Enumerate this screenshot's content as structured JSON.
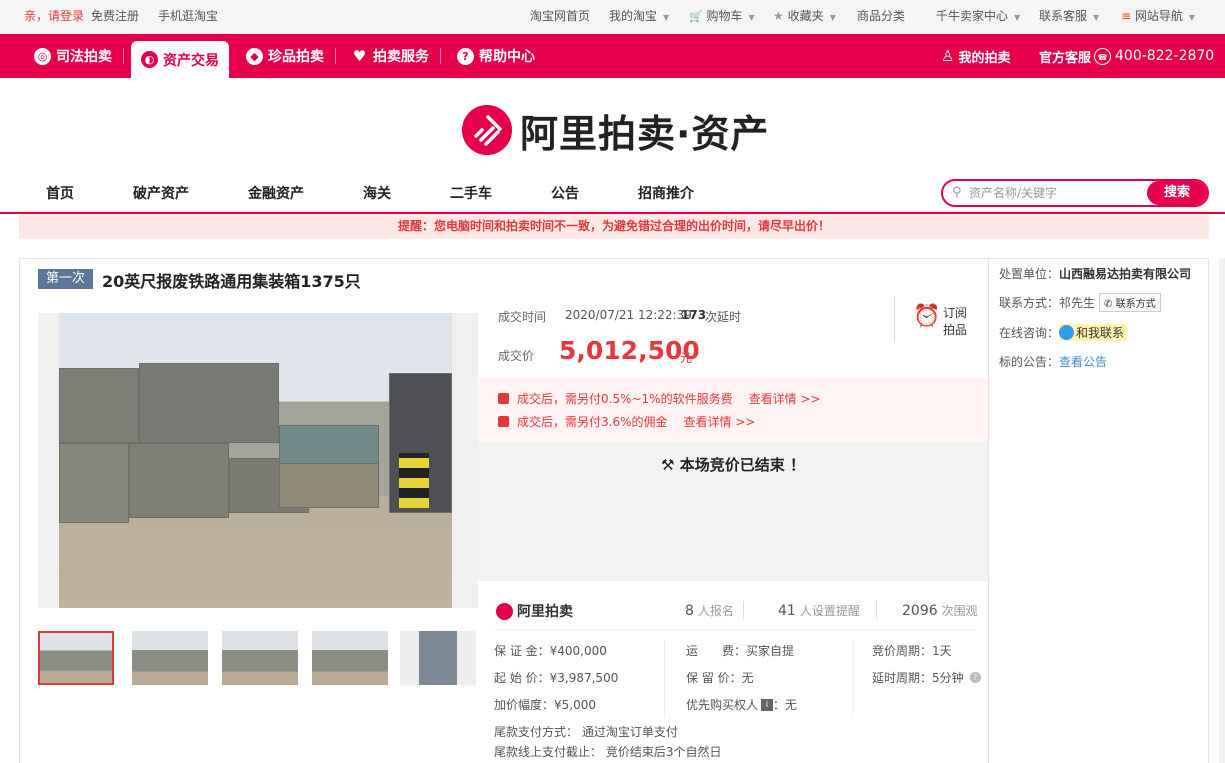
{
  "sitenav": {
    "greet": "亲，请登录",
    "register": "免费注册",
    "mobile": "手机逛淘宝",
    "home": "淘宝网首页",
    "my_taobao": "我的淘宝",
    "cart": "购物车",
    "favorites": "收藏夹",
    "categories": "商品分类",
    "seller_center": "千牛卖家中心",
    "service": "联系客服",
    "site_nav": "网站导航"
  },
  "redbar": {
    "tabs": [
      "司法拍卖",
      "资产交易",
      "珍品拍卖",
      "拍卖服务",
      "帮助中心"
    ],
    "tab_icons": [
      "badge-icon",
      "asset-icon",
      "gem-icon",
      "heart-icon",
      "help-icon"
    ],
    "active_index": 1,
    "my_auction": "我的拍卖",
    "official_service": "官方客服",
    "phone": "400-822-2870"
  },
  "logo": {
    "text": "阿里拍卖·资产"
  },
  "mainnav": {
    "items": [
      "首页",
      "破产资产",
      "金融资产",
      "海关",
      "二手车",
      "公告",
      "招商推介"
    ]
  },
  "search": {
    "placeholder": "资产名称/关键字",
    "button": "搜索"
  },
  "notice": "提醒：您电脑时间和拍卖时间不一致，为避免错过合理的出价时间，请尽早出价！",
  "item": {
    "round": "第一次",
    "title": "20英尺报废铁路通用集装箱1375只",
    "deal_time_label": "成交时间",
    "deal_time": "2020/07/21 12:22:39",
    "delay_count": "173",
    "delay_unit": "次延时",
    "price_label": "成交价",
    "price": "5,012,500",
    "price_unit": "元",
    "subscribe": [
      "订阅",
      "拍品"
    ],
    "fee1": "成交后，需另付0.5%~1%的软件服务费",
    "fee1_more": "查看详情 >>",
    "fee2": "成交后，需另付3.6%的佣金",
    "fee2_more": "查看详情 >>",
    "ended": "本场竞价已结束 ！"
  },
  "panel": {
    "brand": "阿里拍卖",
    "signups": "8",
    "signups_label": "人报名",
    "reminders": "41",
    "reminders_label": "人设置提醒",
    "views": "2096",
    "views_label": "次围观",
    "deposit": "保 证 金：¥400,000",
    "start_price": "起 始 价：¥3,987,500",
    "increment": "加价幅度：¥5,000",
    "shipping": "运　　费：买家自提",
    "reserve": "保 留 价：无",
    "priority": "优先购买权人",
    "priority_val": "：无",
    "cycle": "竞价周期：1天",
    "delay_cycle": "延时周期：5分钟",
    "pay_method": "尾款支付方式：  通过淘宝订单支付",
    "pay_deadline": "尾款线上支付截止：  竞价结束后3个自然日"
  },
  "right": {
    "org_label": "处置单位：",
    "org": "山西融易达拍卖有限公司",
    "contact_label": "联系方式：",
    "contact": "祁先生",
    "contact_btn": "联系方式",
    "consult_label": "在线咨询：",
    "consult_btn": "和我联系",
    "notice_label": "标的公告：",
    "notice_link": "查看公告"
  },
  "colors": {
    "brand": "#e6004c",
    "price": "#e4393c",
    "badge": "#5d7796"
  }
}
